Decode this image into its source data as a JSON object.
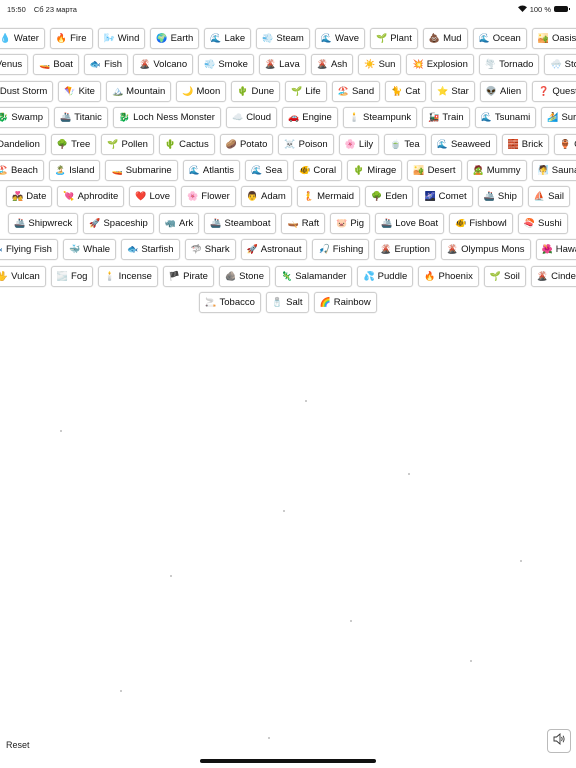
{
  "status_bar": {
    "time": "15:50",
    "date": "Сб 23 марта",
    "battery": "100 %"
  },
  "rows": [
    [
      [
        "💧",
        "Water"
      ],
      [
        "🔥",
        "Fire"
      ],
      [
        "🌬️",
        "Wind"
      ],
      [
        "🌍",
        "Earth"
      ],
      [
        "🌊",
        "Lake"
      ],
      [
        "💨",
        "Steam"
      ],
      [
        "🌊",
        "Wave"
      ],
      [
        "🌱",
        "Plant"
      ],
      [
        "💩",
        "Mud"
      ],
      [
        "🌊",
        "Ocean"
      ],
      [
        "🏜️",
        "Oasis"
      ]
    ],
    [
      [
        "♀",
        "Venus"
      ],
      [
        "🚤",
        "Boat"
      ],
      [
        "🐟",
        "Fish"
      ],
      [
        "🌋",
        "Volcano"
      ],
      [
        "💨",
        "Smoke"
      ],
      [
        "🌋",
        "Lava"
      ],
      [
        "🌋",
        "Ash"
      ],
      [
        "☀️",
        "Sun"
      ],
      [
        "💥",
        "Explosion"
      ],
      [
        "🌪️",
        "Tornado"
      ],
      [
        "🌨️",
        "Storm"
      ]
    ],
    [
      [
        "🌪️",
        "Dust Storm"
      ],
      [
        "🪁",
        "Kite"
      ],
      [
        "🏔️",
        "Mountain"
      ],
      [
        "🌙",
        "Moon"
      ],
      [
        "🌵",
        "Dune"
      ],
      [
        "🌱",
        "Life"
      ],
      [
        "🏖️",
        "Sand"
      ],
      [
        "🐈",
        "Cat"
      ],
      [
        "⭐",
        "Star"
      ],
      [
        "👽",
        "Alien"
      ],
      [
        "❓",
        "Question"
      ]
    ],
    [
      [
        "🐉",
        "Swamp"
      ],
      [
        "🚢",
        "Titanic"
      ],
      [
        "🐉",
        "Loch Ness Monster"
      ],
      [
        "☁️",
        "Cloud"
      ],
      [
        "🚗",
        "Engine"
      ],
      [
        "🕯️",
        "Steampunk"
      ],
      [
        "🚂",
        "Train"
      ],
      [
        "🌊",
        "Tsunami"
      ],
      [
        "🏄",
        "Surf"
      ]
    ],
    [
      [
        "🌼",
        "Dandelion"
      ],
      [
        "🌳",
        "Tree"
      ],
      [
        "🌱",
        "Pollen"
      ],
      [
        "🌵",
        "Cactus"
      ],
      [
        "🥔",
        "Potato"
      ],
      [
        "☠️",
        "Poison"
      ],
      [
        "🌸",
        "Lily"
      ],
      [
        "🍵",
        "Tea"
      ],
      [
        "🌊",
        "Seaweed"
      ],
      [
        "🧱",
        "Brick"
      ],
      [
        "🏺",
        "Clay"
      ]
    ],
    [
      [
        "🏖️",
        "Beach"
      ],
      [
        "🏝️",
        "Island"
      ],
      [
        "🚤",
        "Submarine"
      ],
      [
        "🌊",
        "Atlantis"
      ],
      [
        "🌊",
        "Sea"
      ],
      [
        "🐠",
        "Coral"
      ],
      [
        "🌵",
        "Mirage"
      ],
      [
        "🏜️",
        "Desert"
      ],
      [
        "🧟",
        "Mummy"
      ],
      [
        "🧖",
        "Sauna"
      ]
    ],
    [
      [
        "💑",
        "Date"
      ],
      [
        "💘",
        "Aphrodite"
      ],
      [
        "❤️",
        "Love"
      ],
      [
        "🌸",
        "Flower"
      ],
      [
        "👨",
        "Adam"
      ],
      [
        "🧜",
        "Mermaid"
      ],
      [
        "🌳",
        "Eden"
      ],
      [
        "🌌",
        "Comet"
      ],
      [
        "🚢",
        "Ship"
      ],
      [
        "⛵",
        "Sail"
      ]
    ],
    [
      [
        "🚢",
        "Shipwreck"
      ],
      [
        "🚀",
        "Spaceship"
      ],
      [
        "🦏",
        "Ark"
      ],
      [
        "🚢",
        "Steamboat"
      ],
      [
        "🛶",
        "Raft"
      ],
      [
        "🐷",
        "Pig"
      ],
      [
        "🚢",
        "Love Boat"
      ],
      [
        "🐠",
        "Fishbowl"
      ],
      [
        "🍣",
        "Sushi"
      ]
    ],
    [
      [
        "🐟",
        "Flying Fish"
      ],
      [
        "🐳",
        "Whale"
      ],
      [
        "🐟",
        "Starfish"
      ],
      [
        "🦈",
        "Shark"
      ],
      [
        "🚀",
        "Astronaut"
      ],
      [
        "🎣",
        "Fishing"
      ],
      [
        "🌋",
        "Eruption"
      ],
      [
        "🌋",
        "Olympus Mons"
      ],
      [
        "🌺",
        "Hawaii"
      ]
    ],
    [
      [
        "🖖",
        "Vulcan"
      ],
      [
        "🌫️",
        "Fog"
      ],
      [
        "🕯️",
        "Incense"
      ],
      [
        "🏴",
        "Pirate"
      ],
      [
        "🪨",
        "Stone"
      ],
      [
        "🦎",
        "Salamander"
      ],
      [
        "💦",
        "Puddle"
      ],
      [
        "🔥",
        "Phoenix"
      ],
      [
        "🌱",
        "Soil"
      ],
      [
        "🌋",
        "Cinder"
      ]
    ],
    [
      [
        "🚬",
        "Tobacco"
      ],
      [
        "🧂",
        "Salt"
      ],
      [
        "🌈",
        "Rainbow"
      ]
    ]
  ],
  "footer": {
    "reset_label": "Reset",
    "sound_icon": "speaker-icon"
  }
}
